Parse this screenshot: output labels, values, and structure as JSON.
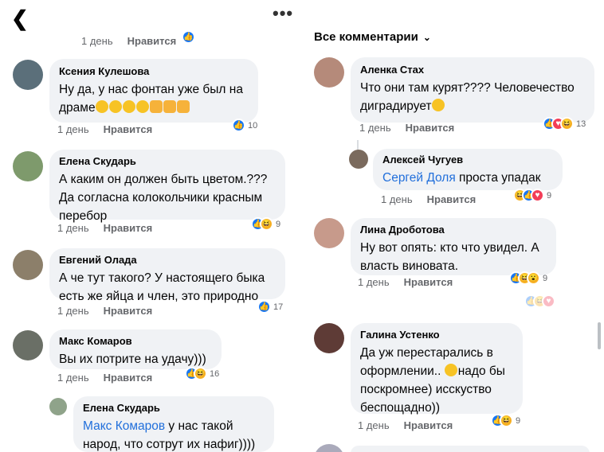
{
  "left": {
    "top_meta": {
      "time": "1 день",
      "like_label": "Нравится"
    },
    "comments": [
      {
        "author": "Ксения Кулешова",
        "text": "Ну да, у нас фонтан уже был на драме",
        "emojis": [
          "laugh",
          "laugh",
          "laugh",
          "laugh",
          "thumb",
          "thumb",
          "thumb"
        ],
        "time": "1 день",
        "like_label": "Нравится",
        "reactions": [
          "like"
        ],
        "count": "10"
      },
      {
        "author": "Елена Скударь",
        "text": "А каким он должен быть цветом.???\nДа согласна колокольчики красным перебор",
        "time": "1 день",
        "like_label": "Нравится",
        "reactions": [
          "like",
          "haha"
        ],
        "count": "9"
      },
      {
        "author": "Евгений Олада",
        "text": "А че тут такого? У настоящего быка есть же яйца и член, это природно",
        "time": "1 день",
        "like_label": "Нравится",
        "reactions": [
          "like"
        ],
        "count": "17"
      },
      {
        "author": "Макс Комаров",
        "text": "Вы их потрите на удачу)))",
        "time": "1 день",
        "like_label": "Нравится",
        "reactions": [
          "like",
          "haha"
        ],
        "count": "16"
      }
    ],
    "reply": {
      "author": "Елена Скударь",
      "mention": "Макс Комаров",
      "text": " у нас такой народ, что сотрут их нафиг))))"
    }
  },
  "right": {
    "filter_label": "Все комментарии",
    "comments": [
      {
        "author": "Аленка Стах",
        "text": "Что они там курят???? Человечество диградирует",
        "emojis": [
          "scream"
        ],
        "time": "1 день",
        "like_label": "Нравится",
        "reactions": [
          "like",
          "love",
          "haha"
        ],
        "count": "13"
      },
      {
        "author": "Лина Дроботова",
        "text": "Ну вот опять: кто что увидел. А власть виновата.",
        "time": "1 день",
        "like_label": "Нравится",
        "reactions": [
          "like",
          "haha",
          "wow"
        ],
        "count": "9"
      },
      {
        "author": "Галина Устенко",
        "text_before": "Да уж перестарались в оформлении.. ",
        "text_after": "надо бы поскромнее) исскуство беспощадно))",
        "time": "1 день",
        "like_label": "Нравится",
        "reactions": [
          "like",
          "haha"
        ],
        "count": "9"
      }
    ],
    "reply": {
      "author": "Алексей Чугуев",
      "mention": "Сергей Доля",
      "text": " проста упадак",
      "time": "1 день",
      "like_label": "Нравится",
      "reactions": [
        "haha",
        "like",
        "love"
      ],
      "count": "9"
    }
  },
  "colors": {
    "bubble": "#f0f2f5",
    "meta": "#65676b",
    "mention": "#216fdb",
    "like": "#1877f2",
    "love": "#f33e58",
    "haha": "#f7b125"
  }
}
